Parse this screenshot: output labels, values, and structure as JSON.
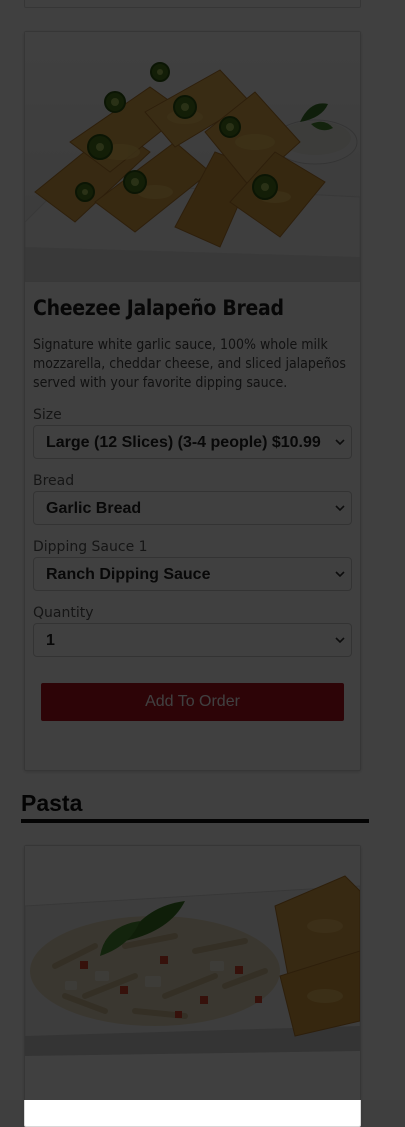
{
  "menu_item": {
    "title": "Cheezee Jalapeño Bread",
    "description": "Signature white garlic sauce, 100% whole milk mozzarella, cheddar cheese, and sliced jalapeños served with your favorite dipping sauce.",
    "image_icon": "cheezee-jalapeno-bread-photo",
    "options": {
      "size": {
        "label": "Size",
        "value": "Large (12 Slices) (3-4 people) $10.99"
      },
      "bread": {
        "label": "Bread",
        "value": "Garlic Bread"
      },
      "dipping_sauce": {
        "label": "Dipping Sauce 1",
        "value": "Ranch Dipping Sauce"
      },
      "quantity": {
        "label": "Quantity",
        "value": "1"
      }
    },
    "add_button_label": "Add To Order"
  },
  "next_section": {
    "title": "Pasta",
    "image_icon": "pasta-dish-photo"
  },
  "colors": {
    "button": "#b3101f",
    "overlay": "rgba(0,0,0,0.75)"
  }
}
